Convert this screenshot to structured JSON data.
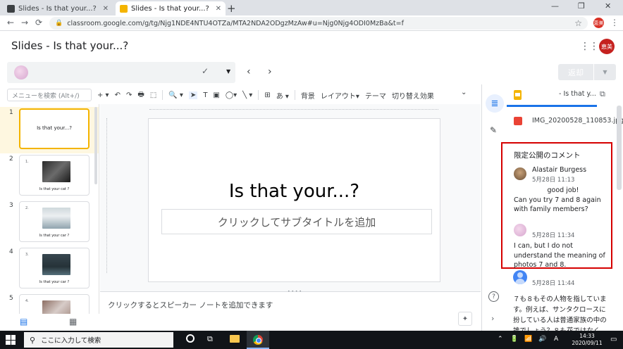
{
  "browser": {
    "tabs": [
      {
        "title": "Slides - Is that your...?",
        "close": "✕"
      },
      {
        "title": "Slides - Is that your...?",
        "close": "✕"
      }
    ],
    "new_tab": "+",
    "window_controls": {
      "minimize": "—",
      "maximize": "❐",
      "close": "✕"
    },
    "nav": {
      "back": "←",
      "forward": "→",
      "reload": "⟳"
    },
    "url": "classroom.google.com/g/tg/Njg1NDE4NTU4OTZa/MTA2NDA2ODgzMzAw#u=Njg0Njg4ODI0MzBa&t=f",
    "profile_label": "恵美",
    "menu": "⋮"
  },
  "header": {
    "title": "Slides - Is that your...?",
    "apps_icon": "⋮⋮⋮",
    "account_label": "恵美"
  },
  "grade_row": {
    "status_check": "✓",
    "caret": "▼",
    "prev": "‹",
    "next": "›",
    "return_label": "返却",
    "return_caret": "▼"
  },
  "toolbar": {
    "search_placeholder": "メニューを検索 (Alt+/)",
    "items": [
      "+ ▾",
      "↶",
      "↷",
      "🖶",
      "⬚",
      "🔍 ▾",
      "➤",
      "T",
      "▣",
      "◯▾",
      "╲ ▾",
      "⊞",
      "あ ▾",
      "背景",
      "レイアウト▾",
      "テーマ",
      "切り替え効果"
    ],
    "collapse": "⌄"
  },
  "filmstrip": {
    "slides": [
      {
        "num": "1",
        "title": "Is that your...?"
      },
      {
        "num": "2",
        "inner_num": "1.",
        "caption": "Is that your cat ?"
      },
      {
        "num": "3",
        "inner_num": "2.",
        "caption": "Is that your car ?"
      },
      {
        "num": "4",
        "inner_num": "3.",
        "caption": "Is that your car ?"
      },
      {
        "num": "5",
        "inner_num": "4.",
        "caption": ""
      }
    ],
    "grid_view": "▤",
    "list_view": "▦"
  },
  "slide": {
    "title": "Is that your...?",
    "subtitle_placeholder": "クリックしてサブタイトルを追加"
  },
  "notes": {
    "placeholder": "クリックするとスピーカー ノートを追加できます",
    "explore": "✦"
  },
  "rail": {
    "files_icon": "≣",
    "comments_icon": "✎",
    "help_icon": "?",
    "expand_icon": "›"
  },
  "panel": {
    "file_name": "- Is that y...",
    "open_icon": "⧉",
    "image_name": "IMG_20200528_110853.jpg",
    "private_heading": "限定公開のコメント",
    "comments": [
      {
        "author": "Alastair Burgess",
        "time": "5月28日 11:13",
        "line1": "good job!",
        "line2": "Can you try 7 and 8 again with family members?"
      },
      {
        "author": "",
        "time": "5月28日 11:34",
        "body": "I can, but I do not understand the meaning of photos 7 and 8."
      },
      {
        "author": "",
        "time": "5月28日 11:44",
        "body": "７も８もその人物を指しています。例えば、サンタクロースに扮している人は普通家族の中の誰でしょう？８も花ではなく..."
      }
    ]
  },
  "taskbar": {
    "search_placeholder": "ここに入力して検索",
    "search_icon": "⚲",
    "taskview": "⧉",
    "tray": [
      "⌃",
      "🔋",
      "📶",
      "🔊",
      "A"
    ],
    "time": "14:33",
    "date": "2020/09/11",
    "notifications": "▭"
  }
}
